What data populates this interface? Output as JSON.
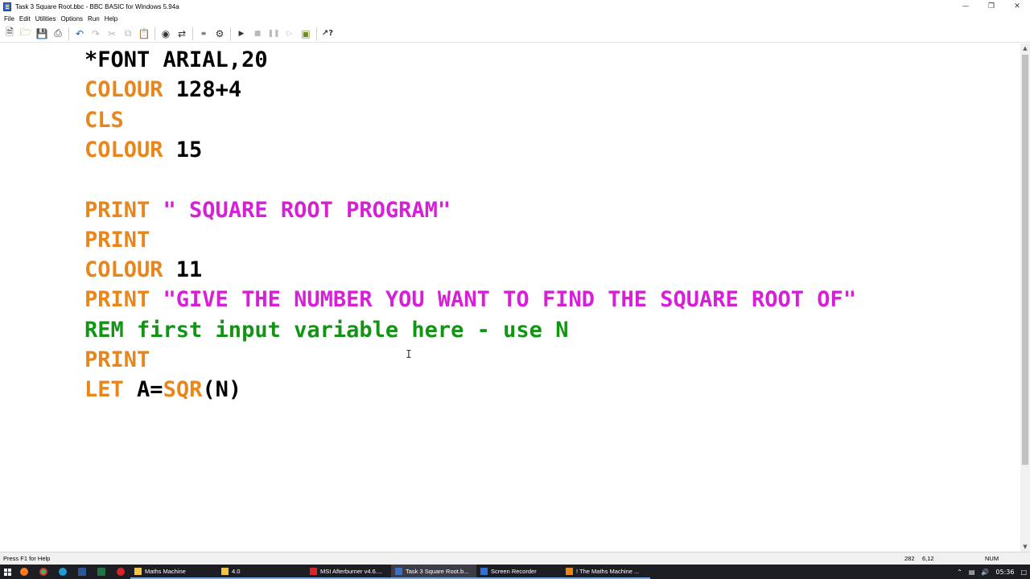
{
  "window": {
    "title": "Task 3  Square Root.bbc - BBC BASIC for Windows 5.94a"
  },
  "menu": [
    "File",
    "Edit",
    "Utilities",
    "Options",
    "Run",
    "Help"
  ],
  "toolbar": {
    "icons": [
      "new-file-icon",
      "open-folder-icon",
      "save-icon",
      "print-icon",
      "undo-icon",
      "redo-icon",
      "cut-icon",
      "copy-icon",
      "paste-icon",
      "find-icon",
      "replace-icon",
      "renumber-icon",
      "compile-icon",
      "run-icon",
      "stop-icon",
      "pause-icon",
      "step-icon",
      "immediate-mode-icon",
      "context-help-icon"
    ]
  },
  "editor": {
    "lines": [
      [
        {
          "t": "*FONT ARIAL,20",
          "c": "pl"
        }
      ],
      [
        {
          "t": "COLOUR",
          "c": "kw"
        },
        {
          "t": " 128+4",
          "c": "pl"
        }
      ],
      [
        {
          "t": "CLS",
          "c": "kw"
        }
      ],
      [
        {
          "t": "COLOUR",
          "c": "kw"
        },
        {
          "t": " 15",
          "c": "pl"
        }
      ],
      [],
      [
        {
          "t": "PRINT",
          "c": "kw"
        },
        {
          "t": " \" SQUARE ROOT PROGRAM\"",
          "c": "st"
        }
      ],
      [
        {
          "t": "PRINT",
          "c": "kw"
        }
      ],
      [
        {
          "t": "COLOUR",
          "c": "kw"
        },
        {
          "t": " 11",
          "c": "pl"
        }
      ],
      [
        {
          "t": "PRINT",
          "c": "kw"
        },
        {
          "t": " \"GIVE THE NUMBER YOU WANT TO FIND THE SQUARE ROOT OF\"",
          "c": "st"
        }
      ],
      [
        {
          "t": "REM first input variable here - use N",
          "c": "rem"
        }
      ],
      [
        {
          "t": "PRINT",
          "c": "kw"
        }
      ],
      [
        {
          "t": "LET",
          "c": "kw"
        },
        {
          "t": " A=",
          "c": "pl"
        },
        {
          "t": "SQR",
          "c": "kw"
        },
        {
          "t": "(N)",
          "c": "pl"
        }
      ]
    ],
    "colors": {
      "keyword": "#e8861c",
      "plain": "#000000",
      "string": "#d61fd6",
      "remark": "#149414"
    }
  },
  "status": {
    "hint": "Press F1 for Help",
    "pos_a": "282",
    "pos_b": "6,12",
    "num": "NUM"
  },
  "taskbar": {
    "apps": [
      {
        "label": "Maths Machine",
        "color": "#f4c542",
        "active": false
      },
      {
        "label": "4.0",
        "color": "#f4c542",
        "active": false
      },
      {
        "label": "MSI Afterburner v4.6....",
        "color": "#d9252a",
        "active": false
      },
      {
        "label": "Task 3  Square Root.b...",
        "color": "#3a6fc4",
        "active": true
      },
      {
        "label": "Screen Recorder",
        "color": "#2f6fd6",
        "active": false
      },
      {
        "label": "! The Maths Machine ...",
        "color": "#e8861c",
        "active": false
      }
    ],
    "clock": "05:36"
  }
}
